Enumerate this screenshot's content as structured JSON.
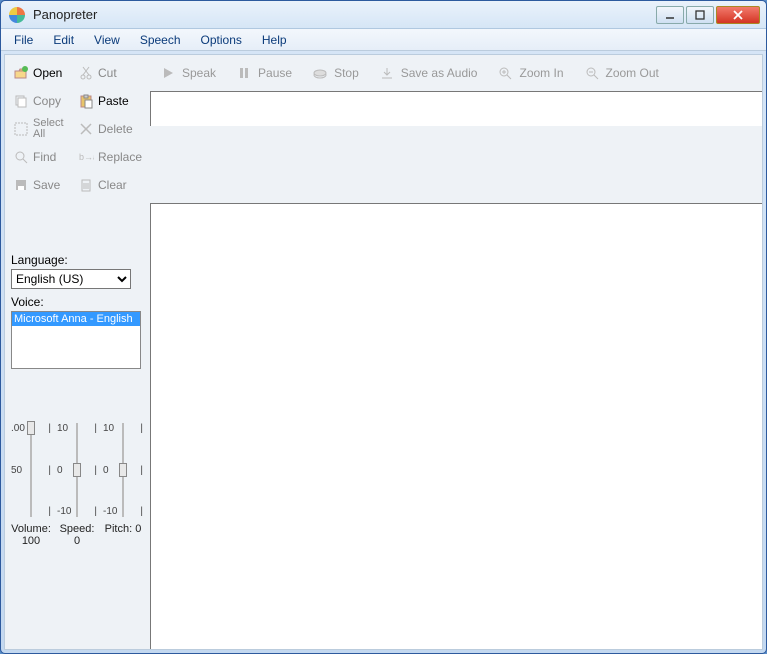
{
  "window": {
    "title": "Panopreter"
  },
  "menu": {
    "file": "File",
    "edit": "Edit",
    "view": "View",
    "speech": "Speech",
    "options": "Options",
    "help": "Help"
  },
  "fileops": {
    "open": "Open",
    "cut": "Cut",
    "copy": "Copy",
    "paste": "Paste",
    "selectall": "Select All",
    "delete": "Delete",
    "find": "Find",
    "replace": "Replace",
    "save": "Save",
    "clear": "Clear"
  },
  "speakbar": {
    "speak": "Speak",
    "pause": "Pause",
    "stop": "Stop",
    "saveaudio": "Save as Audio",
    "zoomin": "Zoom In",
    "zoomout": "Zoom Out"
  },
  "labels": {
    "language": "Language:",
    "voice": "Voice:"
  },
  "language": {
    "selected": "English (US)"
  },
  "voices": [
    "Microsoft Anna - English"
  ],
  "sliders": {
    "volume": {
      "max": ".00",
      "mid": "50",
      "min": "",
      "label": "Volume: 100",
      "thumb_pct": 5
    },
    "speed": {
      "max": "10",
      "mid": "0",
      "min": "-10",
      "label": "Speed: 0",
      "thumb_pct": 50
    },
    "pitch": {
      "max": "10",
      "mid": "0",
      "min": "-10",
      "label": "Pitch: 0",
      "thumb_pct": 50
    }
  },
  "editor": {
    "content": ""
  }
}
